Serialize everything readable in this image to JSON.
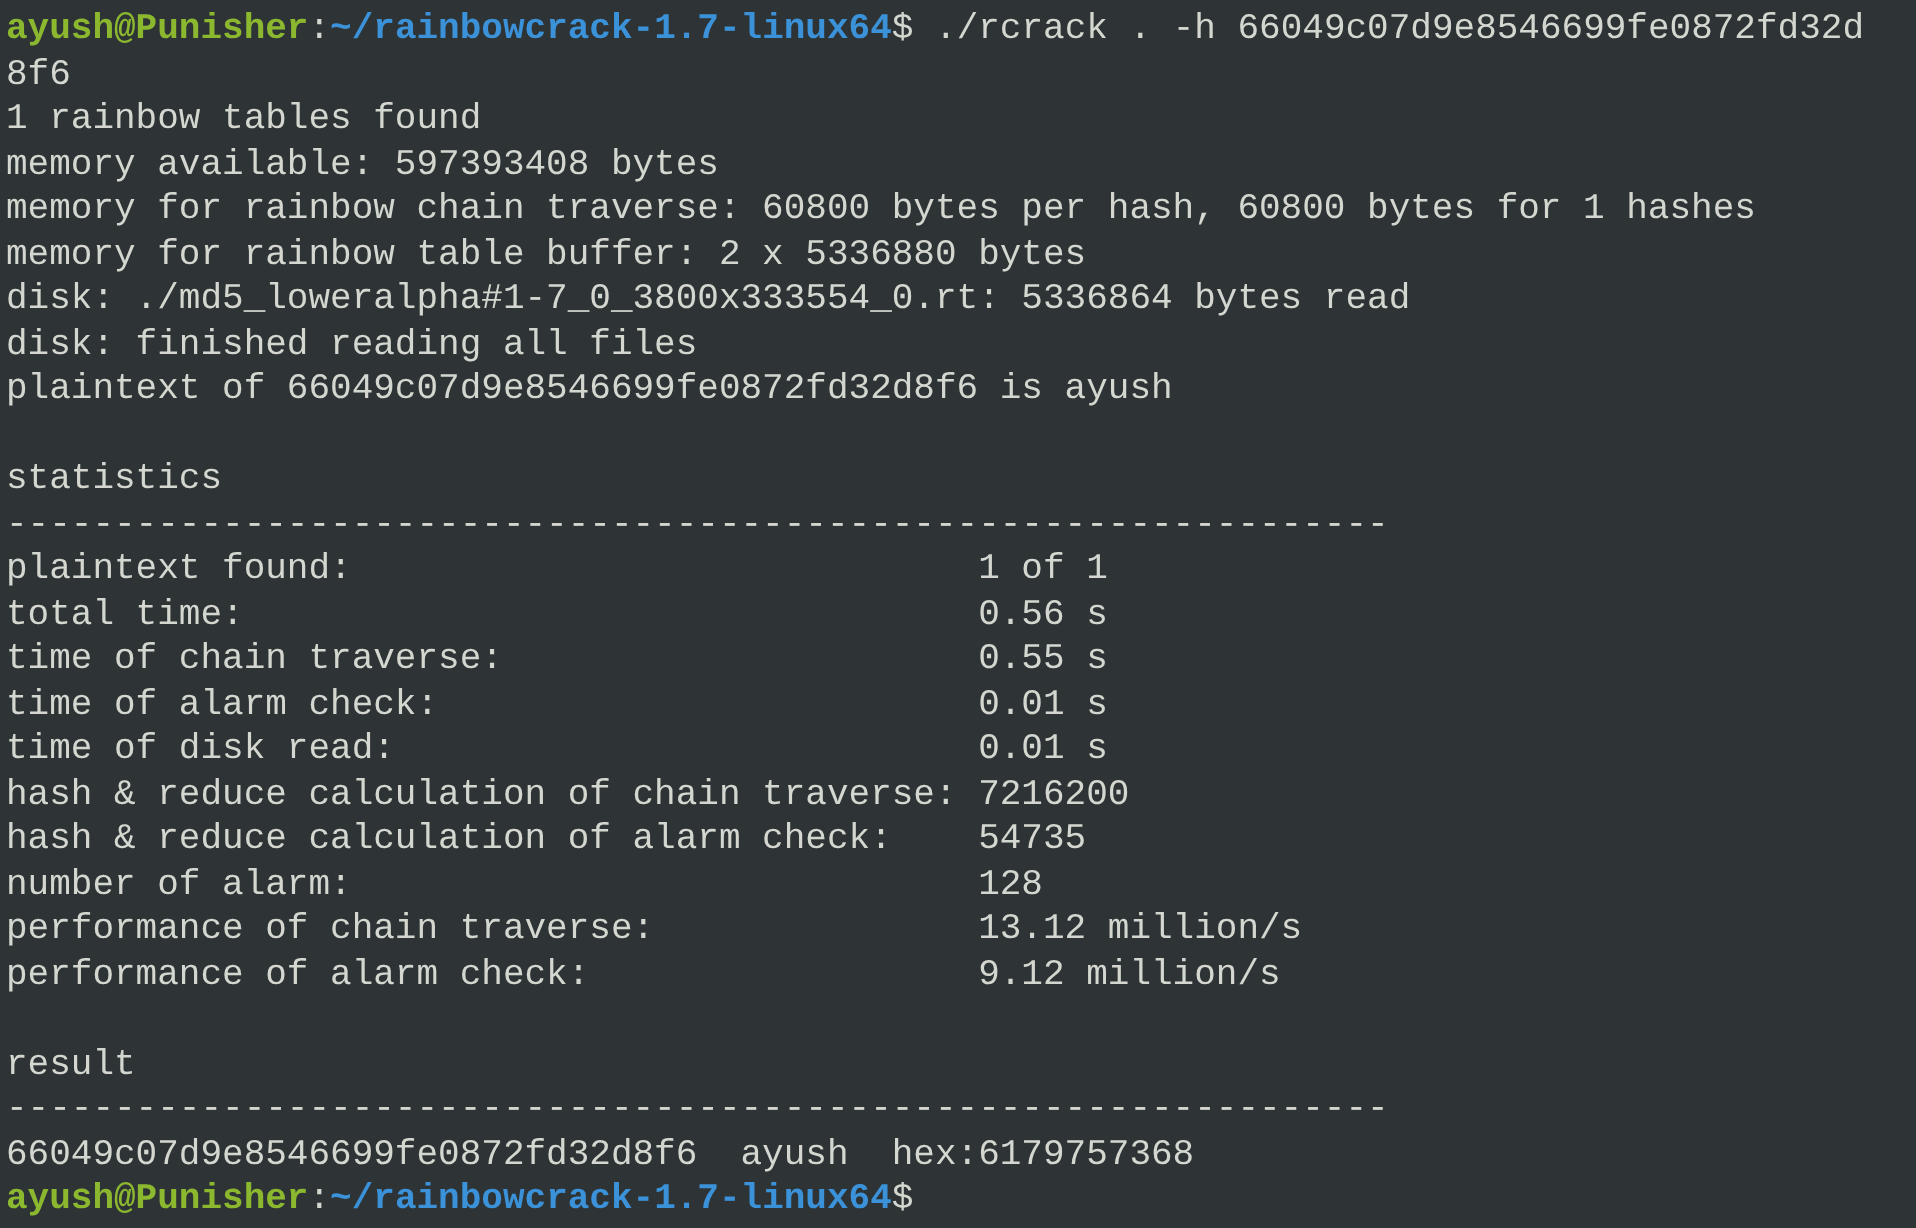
{
  "terminal": {
    "lines": [
      {
        "kind": "prompt",
        "user": "ayush@Punisher",
        "separator": ":",
        "path": "~/rainbowcrack-1.7-linux64",
        "symbol": "$",
        "command": " ./rcrack . -h 66049c07d9e8546699fe0872fd32d8f6"
      },
      {
        "kind": "output",
        "text": "1 rainbow tables found"
      },
      {
        "kind": "output",
        "text": "memory available: 597393408 bytes"
      },
      {
        "kind": "output",
        "text": "memory for rainbow chain traverse: 60800 bytes per hash, 60800 bytes for 1 hashes"
      },
      {
        "kind": "output",
        "text": "memory for rainbow table buffer: 2 x 5336880 bytes"
      },
      {
        "kind": "output",
        "text": "disk: ./md5_loweralpha#1-7_0_3800x333554_0.rt: 5336864 bytes read"
      },
      {
        "kind": "output",
        "text": "disk: finished reading all files"
      },
      {
        "kind": "output",
        "text": "plaintext of 66049c07d9e8546699fe0872fd32d8f6 is ayush"
      },
      {
        "kind": "blank"
      },
      {
        "kind": "output",
        "text": "statistics"
      },
      {
        "kind": "output",
        "text": "----------------------------------------------------------------"
      },
      {
        "kind": "output",
        "text": "plaintext found:                             1 of 1"
      },
      {
        "kind": "output",
        "text": "total time:                                  0.56 s"
      },
      {
        "kind": "output",
        "text": "time of chain traverse:                      0.55 s"
      },
      {
        "kind": "output",
        "text": "time of alarm check:                         0.01 s"
      },
      {
        "kind": "output",
        "text": "time of disk read:                           0.01 s"
      },
      {
        "kind": "output",
        "text": "hash & reduce calculation of chain traverse: 7216200"
      },
      {
        "kind": "output",
        "text": "hash & reduce calculation of alarm check:    54735"
      },
      {
        "kind": "output",
        "text": "number of alarm:                             128"
      },
      {
        "kind": "output",
        "text": "performance of chain traverse:               13.12 million/s"
      },
      {
        "kind": "output",
        "text": "performance of alarm check:                  9.12 million/s"
      },
      {
        "kind": "blank"
      },
      {
        "kind": "output",
        "text": "result"
      },
      {
        "kind": "output",
        "text": "----------------------------------------------------------------"
      },
      {
        "kind": "output",
        "text": "66049c07d9e8546699fe0872fd32d8f6  ayush  hex:6179757368"
      },
      {
        "kind": "prompt",
        "user": "ayush@Punisher",
        "separator": ":",
        "path": "~/rainbowcrack-1.7-linux64",
        "symbol": "$"
      }
    ]
  }
}
